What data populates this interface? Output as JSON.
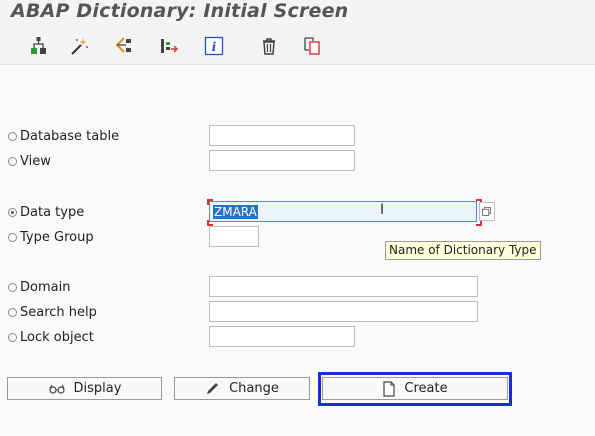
{
  "window": {
    "title": "ABAP Dictionary: Initial Screen"
  },
  "toolbar": {
    "icons": [
      "hierarchy-icon",
      "magic-wand-icon",
      "where-used-icon",
      "object-list-icon",
      "info-icon",
      "trash-icon",
      "copy-icon"
    ]
  },
  "options": {
    "database_table": {
      "label": "Database table",
      "value": "",
      "selected": false
    },
    "view": {
      "label": "View",
      "value": "",
      "selected": false
    },
    "data_type": {
      "label": "Data type",
      "value": "ZMARA",
      "selected": true
    },
    "type_group": {
      "label": "Type Group",
      "value": "",
      "selected": false
    },
    "domain": {
      "label": "Domain",
      "value": "",
      "selected": false
    },
    "search_help": {
      "label": "Search help",
      "value": "",
      "selected": false
    },
    "lock_object": {
      "label": "Lock object",
      "value": "",
      "selected": false
    }
  },
  "tooltip": {
    "text": "Name of Dictionary Type"
  },
  "buttons": {
    "display": "Display",
    "change": "Change",
    "create": "Create"
  },
  "colors": {
    "focus_border": "#1a2ed8",
    "selection": "#2d6fc4",
    "tooltip_bg": "#ffffdc"
  }
}
